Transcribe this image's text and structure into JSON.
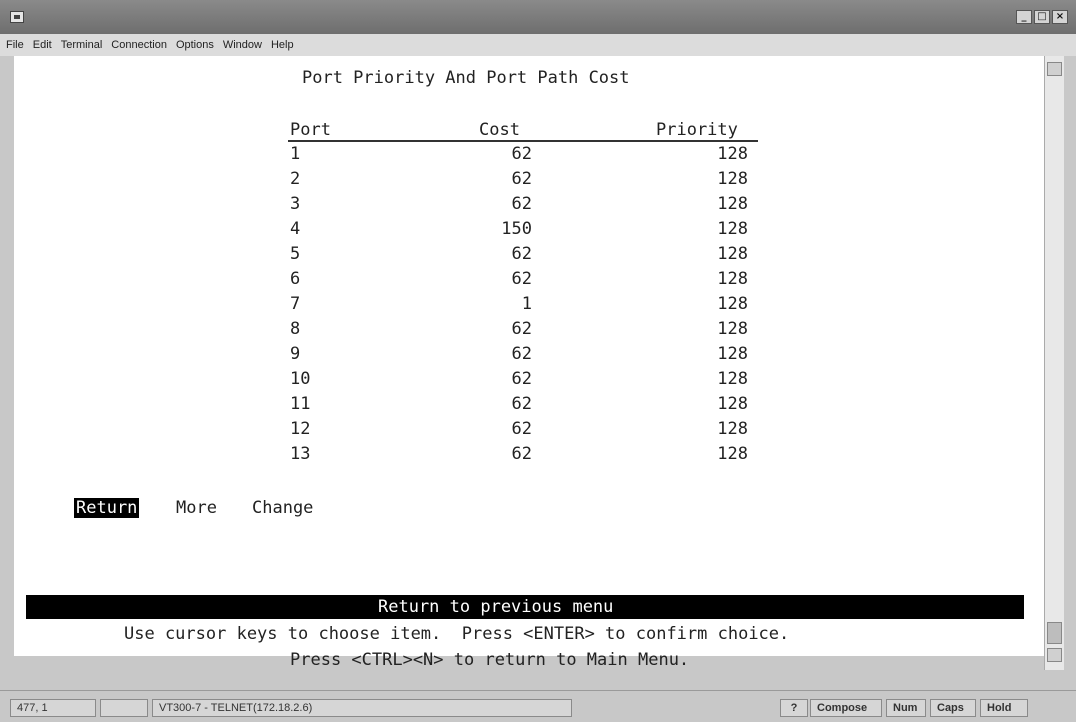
{
  "menubar": [
    "File",
    "Edit",
    "Terminal",
    "Connection",
    "Options",
    "Window",
    "Help"
  ],
  "window_buttons": [
    "_",
    "□",
    "×"
  ],
  "screen": {
    "title": "Port Priority And Port Path Cost",
    "columns": [
      "Port",
      "Cost",
      "Priority"
    ],
    "rows": [
      {
        "port": "1",
        "cost": "62",
        "priority": "128"
      },
      {
        "port": "2",
        "cost": "62",
        "priority": "128"
      },
      {
        "port": "3",
        "cost": "62",
        "priority": "128"
      },
      {
        "port": "4",
        "cost": "150",
        "priority": "128"
      },
      {
        "port": "5",
        "cost": "62",
        "priority": "128"
      },
      {
        "port": "6",
        "cost": "62",
        "priority": "128"
      },
      {
        "port": "7",
        "cost": "1",
        "priority": "128"
      },
      {
        "port": "8",
        "cost": "62",
        "priority": "128"
      },
      {
        "port": "9",
        "cost": "62",
        "priority": "128"
      },
      {
        "port": "10",
        "cost": "62",
        "priority": "128"
      },
      {
        "port": "11",
        "cost": "62",
        "priority": "128"
      },
      {
        "port": "12",
        "cost": "62",
        "priority": "128"
      },
      {
        "port": "13",
        "cost": "62",
        "priority": "128"
      }
    ],
    "actions": [
      "Return",
      "More",
      "Change"
    ],
    "selected_action": "Return",
    "status_message": "Return to previous menu",
    "help_line_1": "Use cursor keys to choose item.  Press <ENTER> to confirm choice.",
    "help_line_2": "Press <CTRL><N> to return to Main Menu."
  },
  "statusbar": {
    "cursor": "477, 1",
    "session": "VT300-7 - TELNET(172.18.2.6)",
    "help": "?",
    "compose": "Compose",
    "num": "Num",
    "caps": "Caps",
    "hold": "Hold"
  }
}
